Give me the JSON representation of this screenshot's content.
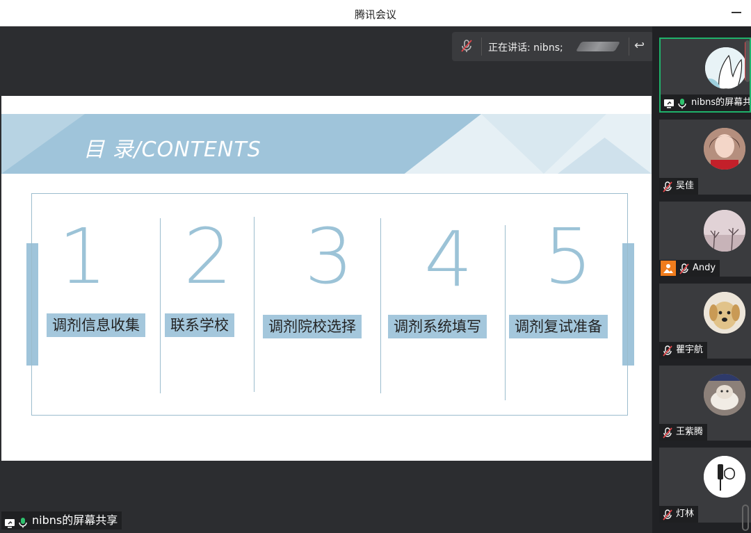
{
  "window": {
    "title": "腾讯会议"
  },
  "speaking": {
    "label": "正在讲话: nibns;"
  },
  "share_label": {
    "text": "nibns的屏幕共享"
  },
  "slide": {
    "heading": "目 录/CONTENTS",
    "items": [
      {
        "number": "1",
        "label": "调剂信息收集"
      },
      {
        "number": "2",
        "label": "联系学校"
      },
      {
        "number": "3",
        "label": "调剂院校选择"
      },
      {
        "number": "4",
        "label": "调剂系统填写"
      },
      {
        "number": "5",
        "label": "调剂复试准备"
      }
    ]
  },
  "participants": [
    {
      "name": "nibns的屏幕共",
      "mic": "on",
      "sharing": true,
      "active": true
    },
    {
      "name": "吴佳",
      "mic": "muted"
    },
    {
      "name": "Andy",
      "mic": "muted",
      "badge": "image-icon"
    },
    {
      "name": "瞿宇航",
      "mic": "muted"
    },
    {
      "name": "王紫腾",
      "mic": "muted"
    },
    {
      "name": "灯林",
      "mic": "muted"
    }
  ],
  "colors": {
    "accent": "#9fc4da",
    "active_border": "#1fb26b",
    "mic_on": "#2fc26e",
    "badge": "#f07c1c"
  }
}
